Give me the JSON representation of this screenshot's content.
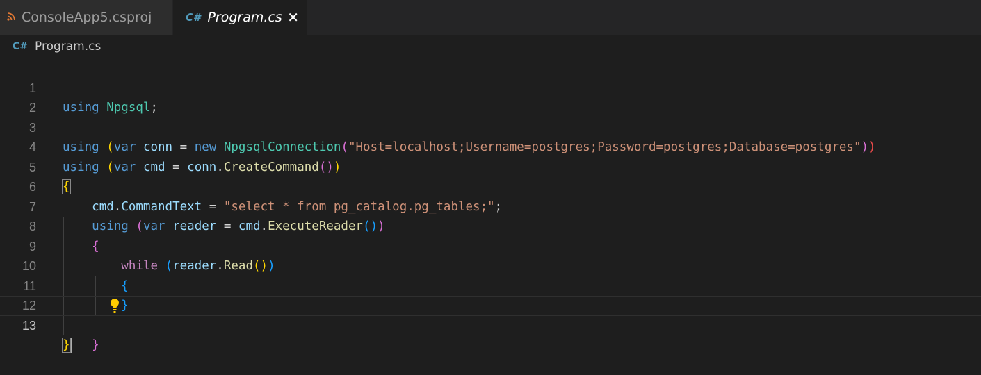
{
  "tabs": [
    {
      "label": "ConsoleApp5.csproj",
      "icon": "rss-icon",
      "active": false
    },
    {
      "label": "Program.cs",
      "icon": "csharp-icon",
      "active": true,
      "close": "✕"
    }
  ],
  "breadcrumb": {
    "label": "Program.cs",
    "icon_glyph": "C#"
  },
  "editor": {
    "current_line": 13,
    "line_numbers": [
      "1",
      "2",
      "3",
      "4",
      "5",
      "6",
      "7",
      "8",
      "9",
      "10",
      "11",
      "12",
      "13"
    ],
    "lines": [
      "using Npgsql;",
      "",
      "using (var conn = new NpgsqlConnection(\"Host=localhost;Username=postgres;Password=postgres;Database=postgres\"))",
      "using (var cmd = conn.CreateCommand())",
      "{",
      "    cmd.CommandText = \"select * from pg_catalog.pg_tables;\";",
      "    using (var reader = cmd.ExecuteReader())",
      "    {",
      "        while (reader.Read())",
      "        {",
      "        }",
      "    }",
      "}"
    ],
    "tokens": {
      "l1_kw": "using",
      "l1_ns": "Npgsql",
      "l1_semi": ";",
      "l3_kw": "using",
      "l3_var": "var",
      "l3_conn": "conn",
      "l3_eq": " = ",
      "l3_new": "new",
      "l3_type": "NpgsqlConnection",
      "l3_str": "\"Host=localhost;Username=postgres;Password=postgres;Database=postgres\"",
      "l4_kw": "using",
      "l4_var": "var",
      "l4_cmd": "cmd",
      "l4_eq": " = ",
      "l4_conn": "conn",
      "l4_fn": "CreateCommand",
      "l5_brace": "{",
      "l6_cmd": "cmd",
      "l6_prop": "CommandText",
      "l6_eq": " = ",
      "l6_str": "\"select * from pg_catalog.pg_tables;\"",
      "l6_semi": ";",
      "l7_kw": "using",
      "l7_var": "var",
      "l7_reader": "reader",
      "l7_eq": " = ",
      "l7_cmd": "cmd",
      "l7_fn": "ExecuteReader",
      "l8_brace": "{",
      "l9_kw": "while",
      "l9_reader": "reader",
      "l9_fn": "Read",
      "l10_brace": "{",
      "l11_brace": "}",
      "l12_brace": "}",
      "l13_brace": "}"
    }
  },
  "colors": {
    "background": "#1e1e1e",
    "keyword": "#569cd6",
    "control_keyword": "#c586c0",
    "type": "#4ec9b0",
    "variable": "#9cdcfe",
    "function": "#dcdcaa",
    "string": "#ce9178",
    "lightbulb": "#ffcc00"
  }
}
